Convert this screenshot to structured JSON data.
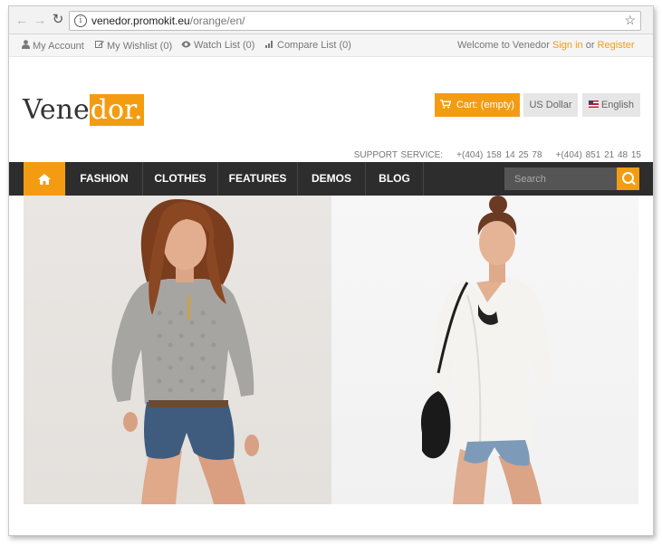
{
  "browser": {
    "back_icon": "arrow-left-icon",
    "forward_icon": "arrow-right-icon",
    "reload_icon": "reload-icon",
    "url_host": "venedor.promokit.eu",
    "url_path": "/orange/en/",
    "bookmark_icon": "star-icon"
  },
  "topbar": {
    "my_account": "My Account",
    "my_wishlist": "My Wishlist (0)",
    "watch_list": "Watch List (0)",
    "compare_list": "Compare List (0)",
    "welcome": "Welcome to Venedor",
    "sign_in": "Sign in",
    "or": "or",
    "register": "Register"
  },
  "header": {
    "logo_part1": "Vene",
    "logo_part2": "dor.",
    "cart_label": "Cart: (empty)",
    "currency_label": "US Dollar",
    "language_label": "English",
    "support_label": "SUPPORT SERVICE:",
    "phone_1": "+(404) 158 14 25 78",
    "phone_2": "+(404) 851 21 48 15"
  },
  "nav": {
    "items": [
      {
        "label": "FASHION"
      },
      {
        "label": "CLOTHES"
      },
      {
        "label": "FEATURES"
      },
      {
        "label": "DEMOS"
      },
      {
        "label": "BLOG"
      }
    ],
    "search_placeholder": "Search"
  },
  "colors": {
    "accent": "#f39c12",
    "nav_background": "#2d2d2d"
  }
}
